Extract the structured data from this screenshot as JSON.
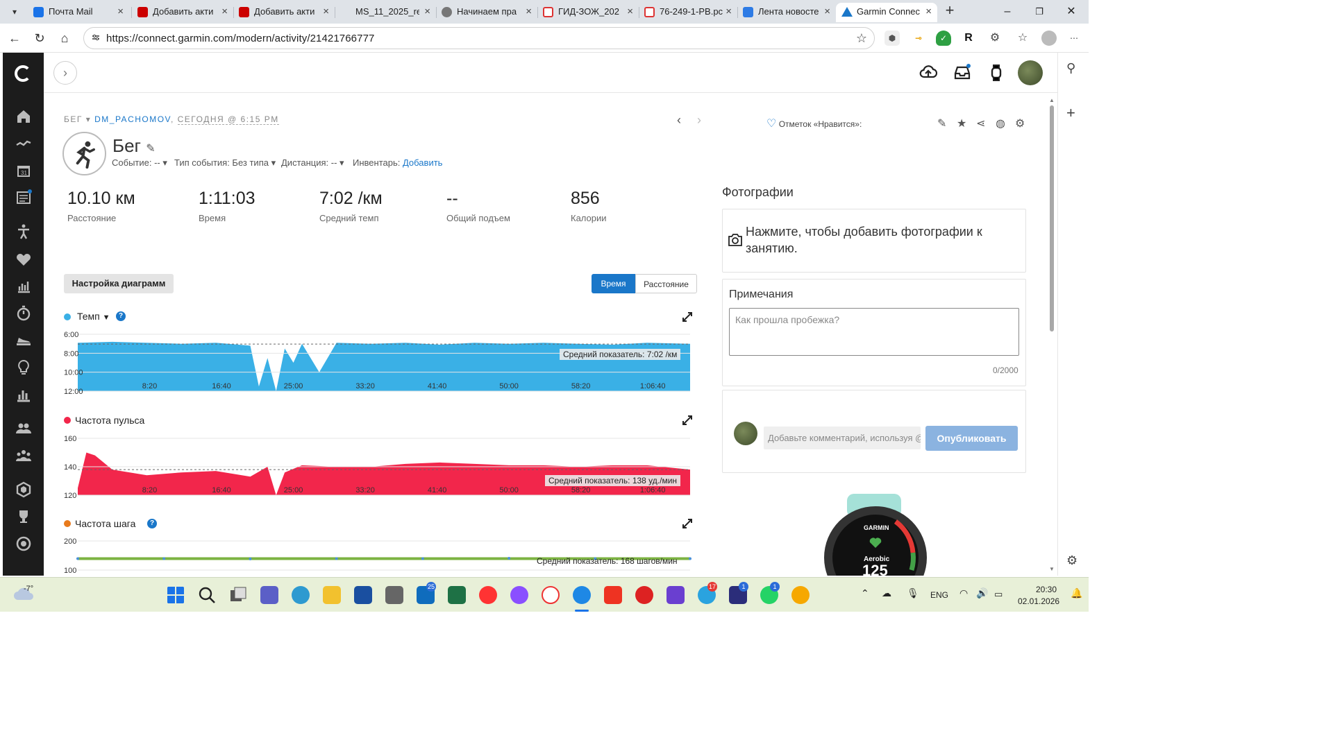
{
  "browser": {
    "tabs": [
      {
        "title": "Почта Mail",
        "color": "#1a73e8"
      },
      {
        "title": "Добавить акти",
        "color": "#c00"
      },
      {
        "title": "Добавить акти",
        "color": "#c00"
      },
      {
        "title": "MS_11_2025_re",
        "color": "#888"
      },
      {
        "title": "Начинаем пра",
        "color": "#777"
      },
      {
        "title": "ГИД-ЗОЖ_202",
        "color": "#d33"
      },
      {
        "title": "76-249-1-PB.pc",
        "color": "#d33"
      },
      {
        "title": "Лента новосте",
        "color": "#2d7be5"
      },
      {
        "title": "Garmin Connec",
        "color": "#1a77c9"
      }
    ],
    "url": "https://connect.garmin.com/modern/activity/21421766777"
  },
  "activity": {
    "breadcrumb_type": "БЕГ",
    "breadcrumb_user": "DM_PACHOMOV",
    "breadcrumb_date": "СЕГОДНЯ @ 6:15 PM",
    "title": "Бег",
    "event_label": "Событие: --",
    "event_type_label": "Тип события: Без типа",
    "distance_label": "Дистанция: --",
    "gear_label": "Инвентарь:",
    "gear_link": "Добавить"
  },
  "stats": [
    {
      "value": "10.10 км",
      "label": "Расстояние"
    },
    {
      "value": "1:11:03",
      "label": "Время"
    },
    {
      "value": "7:02 /км",
      "label": "Средний темп"
    },
    {
      "value": "--",
      "label": "Общий подъем"
    },
    {
      "value": "856",
      "label": "Калории"
    }
  ],
  "controls": {
    "chart_settings": "Настройка диаграмм",
    "toggle_time": "Время",
    "toggle_distance": "Расстояние"
  },
  "charts_meta": {
    "pace_title": "Темп",
    "hr_title": "Частота пульса",
    "cadence_title": "Частота шага",
    "pace_avg": "Средний показатель: 7:02 /км",
    "hr_avg": "Средний показатель: 138 уд./мин",
    "cadence_avg": "Средний показатель: 168 шагов/мин",
    "colors": {
      "pace": "#3ab0e6",
      "hr": "#f2264b",
      "cadence": "#e87a1c",
      "cadence_green": "#7cb342"
    }
  },
  "chart_data": [
    {
      "type": "area",
      "title": "Темп",
      "x_ticks": [
        "8:20",
        "16:40",
        "25:00",
        "33:20",
        "41:40",
        "50:00",
        "58:20",
        "1:06:40"
      ],
      "y_ticks": [
        "6:00",
        "8:00",
        "10:00",
        "12:00"
      ],
      "x_minutes": [
        0,
        4,
        8,
        12,
        16,
        20,
        21,
        22,
        23,
        24,
        25,
        26,
        28,
        30,
        34,
        38,
        42,
        46,
        50,
        54,
        58,
        62,
        66,
        71
      ],
      "pace_min_per_km": [
        6.9,
        6.8,
        6.9,
        7.0,
        6.9,
        7.2,
        11.5,
        8.5,
        12.0,
        7.5,
        9.0,
        7.0,
        10.0,
        6.9,
        7.0,
        6.9,
        7.1,
        6.9,
        7.0,
        6.9,
        7.0,
        7.1,
        6.9,
        7.0
      ],
      "average": "7:02 /км"
    },
    {
      "type": "area",
      "title": "Частота пульса",
      "x_ticks": [
        "8:20",
        "16:40",
        "25:00",
        "33:20",
        "41:40",
        "50:00",
        "58:20",
        "1:06:40"
      ],
      "y_ticks": [
        160,
        140,
        120
      ],
      "x_minutes": [
        0,
        1,
        2,
        4,
        8,
        12,
        16,
        20,
        22,
        23,
        24,
        26,
        30,
        34,
        38,
        42,
        46,
        50,
        54,
        58,
        62,
        66,
        71
      ],
      "bpm": [
        125,
        150,
        148,
        138,
        134,
        136,
        137,
        133,
        140,
        120,
        136,
        141,
        140,
        140,
        142,
        143,
        142,
        141,
        141,
        140,
        141,
        141,
        138
      ],
      "average": "138 уд./мин"
    },
    {
      "type": "scatter",
      "title": "Частота шага",
      "y_ticks": [
        200,
        100
      ],
      "x_minutes": [
        0,
        10,
        20,
        30,
        40,
        50,
        60,
        71
      ],
      "spm": [
        168,
        168,
        167,
        168,
        168,
        169,
        168,
        168
      ],
      "average": "168 шагов/мин"
    }
  ],
  "social": {
    "likes_label": "Отметок «Нравится»:"
  },
  "photos": {
    "heading": "Фотографии",
    "prompt": "Нажмите, чтобы добавить фотографии к занятию."
  },
  "notes": {
    "heading": "Примечания",
    "placeholder": "Как прошла пробежка?",
    "counter": "0/2000"
  },
  "comment": {
    "placeholder": "Добавьте комментарий, используя @",
    "publish": "Опубликовать"
  },
  "taskbar": {
    "weather": "-7°",
    "lang": "ENG",
    "time": "20:30",
    "date": "02.01.2026",
    "badges": {
      "outlook": "25",
      "telegram": "17",
      "messenger": "1",
      "whatsapp": "1"
    }
  }
}
